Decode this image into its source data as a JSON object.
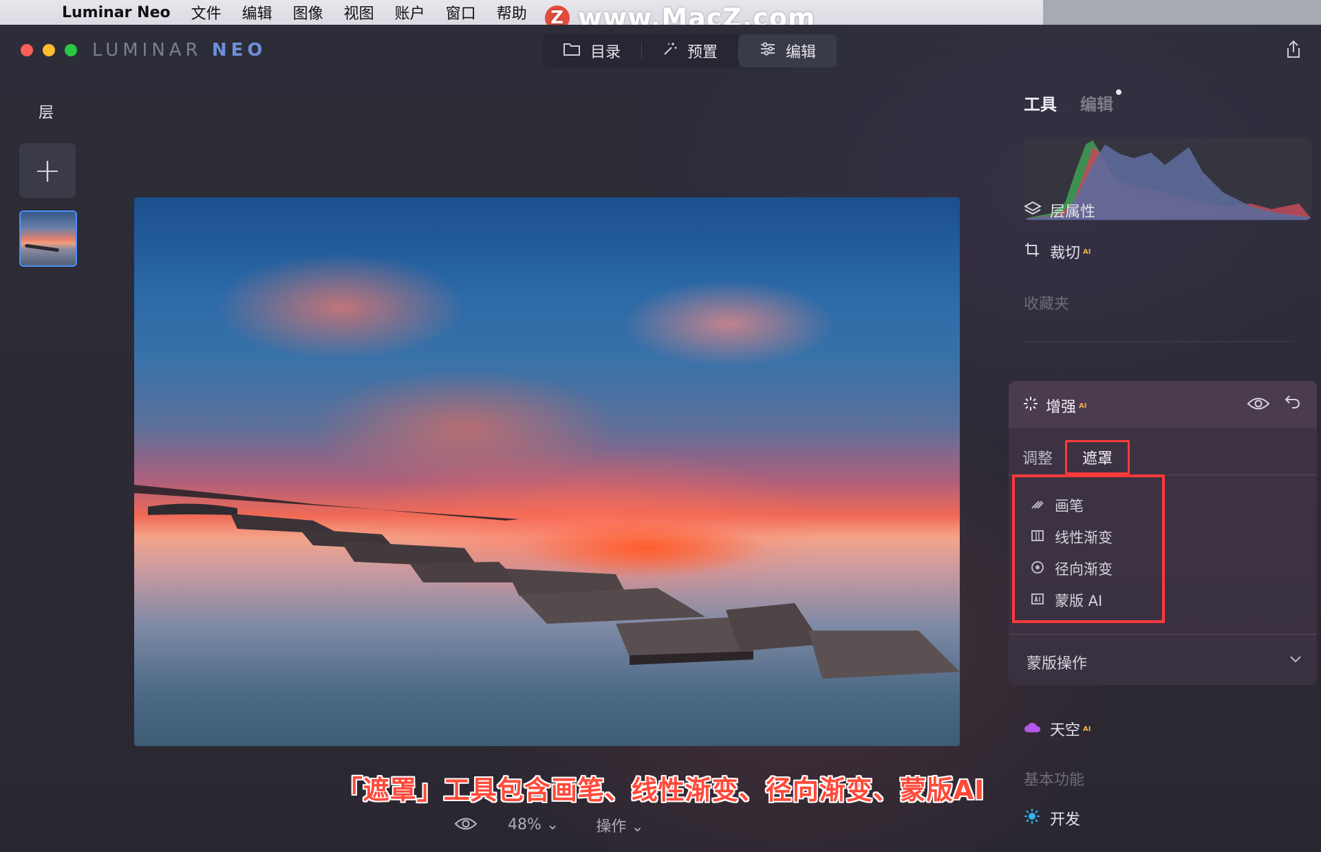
{
  "menubar": {
    "app_name": "Luminar Neo",
    "items": [
      "文件",
      "编辑",
      "图像",
      "视图",
      "账户",
      "窗口",
      "帮助"
    ]
  },
  "watermark": {
    "badge": "Z",
    "text": "www.MacZ.com"
  },
  "window": {
    "logo_main": "LUMINAR ",
    "logo_neo": "NEO",
    "modes": [
      {
        "label": "目录",
        "icon": "folder-icon"
      },
      {
        "label": "预置",
        "icon": "magic-wand-icon"
      },
      {
        "label": "编辑",
        "icon": "sliders-icon",
        "active": true
      }
    ]
  },
  "layers": {
    "title": "层",
    "add_symbol": "+"
  },
  "right_panel": {
    "tab_tools": "工具",
    "tab_edits": "编辑",
    "layer_props": "层属性",
    "crop": "裁切",
    "crop_badge": "AI",
    "favorites": "收藏夹",
    "enhance": {
      "title": "增强",
      "badge": "AI",
      "tab_adjust": "调整",
      "tab_mask": "遮罩",
      "mask_items": [
        {
          "label": "画笔",
          "icon": "brush-icon"
        },
        {
          "label": "线性渐变",
          "icon": "linear-gradient-icon"
        },
        {
          "label": "径向渐变",
          "icon": "radial-gradient-icon"
        },
        {
          "label": "蒙版 AI",
          "icon": "mask-ai-icon"
        }
      ],
      "mask_ops": "蒙版操作"
    },
    "sky": "天空",
    "sky_badge": "AI",
    "basic": "基本功能",
    "develop": "开发"
  },
  "caption": "「遮罩」工具包含画笔、线性渐变、径向渐变、蒙版AI",
  "bottom_bar": {
    "zoom": "48%",
    "actions": "操作"
  },
  "colors": {
    "accent_red": "#ff3b3b",
    "caption_red": "#ff4a3a",
    "selection_blue": "#4f8ef7"
  }
}
